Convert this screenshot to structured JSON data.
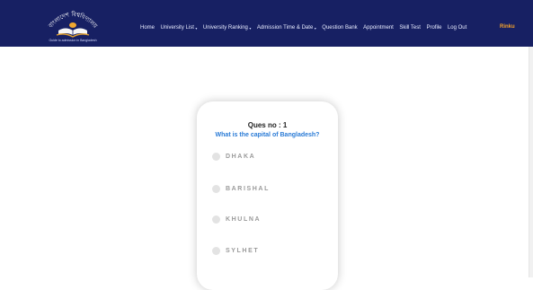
{
  "navbar": {
    "logo_text": "বাংলাদেশ বিশ্ববিদ্যালয়",
    "tagline": "Guide to admission in Bangladesh",
    "items": [
      {
        "label": "Home",
        "has_caret": false
      },
      {
        "label": "University List",
        "has_caret": true
      },
      {
        "label": "University Ranking",
        "has_caret": true
      },
      {
        "label": "Admission Time & Date",
        "has_caret": true
      },
      {
        "label": "Question Bank",
        "has_caret": false
      },
      {
        "label": "Appointment",
        "has_caret": false
      },
      {
        "label": "Skill Test",
        "has_caret": false
      },
      {
        "label": "Profile",
        "has_caret": false
      },
      {
        "label": "Log Out",
        "has_caret": false
      }
    ],
    "user": "Rinku"
  },
  "quiz": {
    "ques_no": "Ques no : 1",
    "question": "What is the capital of Bangladesh?",
    "options": [
      {
        "label": "DHAKA"
      },
      {
        "label": "BARISHAL"
      },
      {
        "label": "KHULNA"
      },
      {
        "label": "SYLHET"
      }
    ]
  },
  "colors": {
    "navbar_bg": "#172063",
    "user_accent": "#f4a22a",
    "question_text": "#2a7bd6"
  }
}
